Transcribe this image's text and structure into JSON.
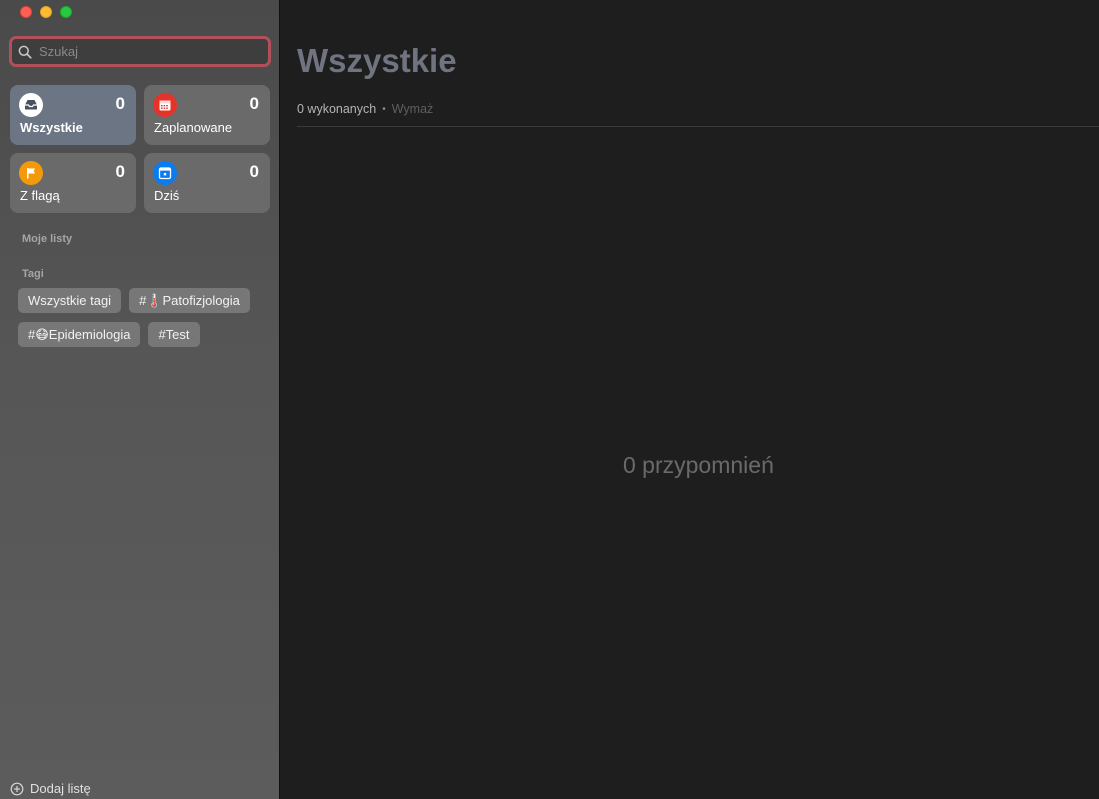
{
  "window": {
    "traffic_lights": [
      "close",
      "minimize",
      "zoom"
    ]
  },
  "sidebar": {
    "search": {
      "placeholder": "Szukaj",
      "value": ""
    },
    "smart_lists": [
      {
        "label": "Wszystkie",
        "count": "0",
        "icon": "tray-icon",
        "color": "#ffffff"
      },
      {
        "label": "Zaplanowane",
        "count": "0",
        "icon": "calendar-icon",
        "color": "#e5332a"
      },
      {
        "label": "Z flagą",
        "count": "0",
        "icon": "flag-icon",
        "color": "#f49a0a"
      },
      {
        "label": "Dziś",
        "count": "0",
        "icon": "today-icon",
        "color": "#0a7cf2"
      }
    ],
    "my_lists_label": "Moje listy",
    "tags_label": "Tagi",
    "tags": [
      {
        "label": "Wszystkie tagi"
      },
      {
        "label": "#🌡️Patofizjologia"
      },
      {
        "label": "#😷Epidemiologia"
      },
      {
        "label": "#Test"
      }
    ],
    "add_list_label": "Dodaj listę"
  },
  "main": {
    "title": "Wszystkie",
    "done_count": "0 wykonanych",
    "separator": "•",
    "clear_label": "Wymaż",
    "empty_text": "0 przypomnień"
  }
}
